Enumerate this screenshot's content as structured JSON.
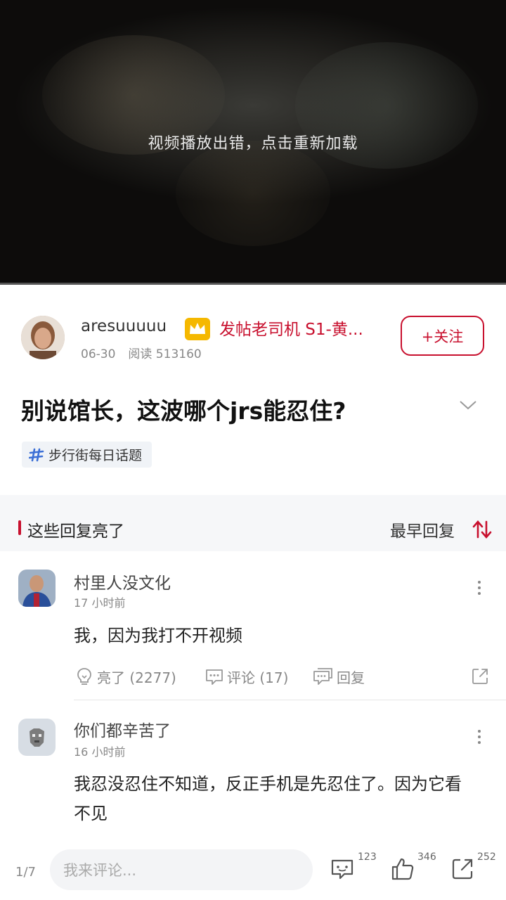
{
  "video": {
    "error_message": "视频播放出错，点击重新加载"
  },
  "post": {
    "author": "aresuuuuu",
    "badge": "发帖老司机 S1-黄...",
    "date": "06-30",
    "reads": "阅读 513160",
    "follow_label": "+关注",
    "title": "别说馆长，这波哪个jrs能忍住?",
    "topic": "步行街每日话题"
  },
  "section": {
    "label": "这些回复亮了",
    "sort_label": "最早回复"
  },
  "comments": [
    {
      "name": "村里人没文化",
      "time": "17 小时前",
      "body": "我，因为我打不开视频",
      "like": "亮了 (2277)",
      "comment": "评论 (17)",
      "reply": "回复"
    },
    {
      "name": "你们都辛苦了",
      "time": "16 小时前",
      "body": "我忍没忍住不知道，反正手机是先忍住了。因为它看不见"
    }
  ],
  "bottom_bar": {
    "page_indicator": "1/7",
    "comment_placeholder": "我来评论...",
    "comment_count": "123",
    "like_count": "346",
    "share_count": "252"
  },
  "colors": {
    "accent": "#c8102e"
  },
  "icons": [
    "crown-badge-icon",
    "chevron-down-icon",
    "hashtag-icon",
    "sort-icon",
    "more-vertical-icon",
    "lightbulb-icon",
    "comment-bubble-icon",
    "reply-bubble-icon",
    "share-icon",
    "thumbs-up-icon"
  ]
}
